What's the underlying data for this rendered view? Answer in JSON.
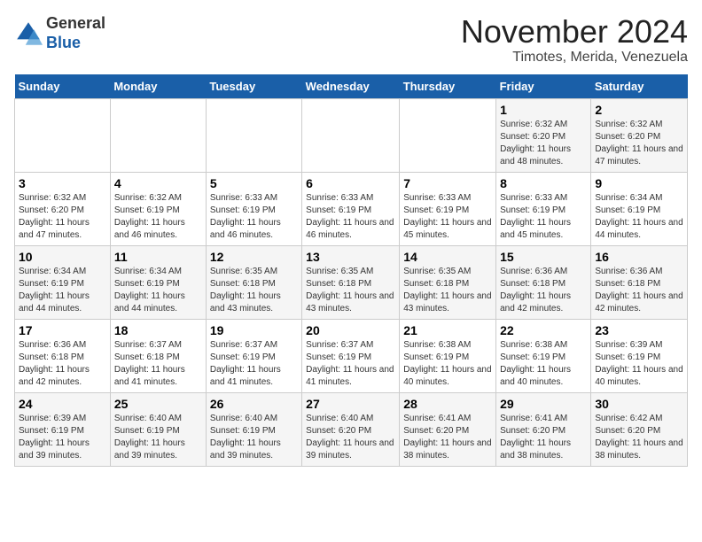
{
  "logo": {
    "general": "General",
    "blue": "Blue"
  },
  "header": {
    "month": "November 2024",
    "location": "Timotes, Merida, Venezuela"
  },
  "days_of_week": [
    "Sunday",
    "Monday",
    "Tuesday",
    "Wednesday",
    "Thursday",
    "Friday",
    "Saturday"
  ],
  "weeks": [
    [
      {
        "day": "",
        "info": ""
      },
      {
        "day": "",
        "info": ""
      },
      {
        "day": "",
        "info": ""
      },
      {
        "day": "",
        "info": ""
      },
      {
        "day": "",
        "info": ""
      },
      {
        "day": "1",
        "info": "Sunrise: 6:32 AM\nSunset: 6:20 PM\nDaylight: 11 hours and 48 minutes."
      },
      {
        "day": "2",
        "info": "Sunrise: 6:32 AM\nSunset: 6:20 PM\nDaylight: 11 hours and 47 minutes."
      }
    ],
    [
      {
        "day": "3",
        "info": "Sunrise: 6:32 AM\nSunset: 6:20 PM\nDaylight: 11 hours and 47 minutes."
      },
      {
        "day": "4",
        "info": "Sunrise: 6:32 AM\nSunset: 6:19 PM\nDaylight: 11 hours and 46 minutes."
      },
      {
        "day": "5",
        "info": "Sunrise: 6:33 AM\nSunset: 6:19 PM\nDaylight: 11 hours and 46 minutes."
      },
      {
        "day": "6",
        "info": "Sunrise: 6:33 AM\nSunset: 6:19 PM\nDaylight: 11 hours and 46 minutes."
      },
      {
        "day": "7",
        "info": "Sunrise: 6:33 AM\nSunset: 6:19 PM\nDaylight: 11 hours and 45 minutes."
      },
      {
        "day": "8",
        "info": "Sunrise: 6:33 AM\nSunset: 6:19 PM\nDaylight: 11 hours and 45 minutes."
      },
      {
        "day": "9",
        "info": "Sunrise: 6:34 AM\nSunset: 6:19 PM\nDaylight: 11 hours and 44 minutes."
      }
    ],
    [
      {
        "day": "10",
        "info": "Sunrise: 6:34 AM\nSunset: 6:19 PM\nDaylight: 11 hours and 44 minutes."
      },
      {
        "day": "11",
        "info": "Sunrise: 6:34 AM\nSunset: 6:19 PM\nDaylight: 11 hours and 44 minutes."
      },
      {
        "day": "12",
        "info": "Sunrise: 6:35 AM\nSunset: 6:18 PM\nDaylight: 11 hours and 43 minutes."
      },
      {
        "day": "13",
        "info": "Sunrise: 6:35 AM\nSunset: 6:18 PM\nDaylight: 11 hours and 43 minutes."
      },
      {
        "day": "14",
        "info": "Sunrise: 6:35 AM\nSunset: 6:18 PM\nDaylight: 11 hours and 43 minutes."
      },
      {
        "day": "15",
        "info": "Sunrise: 6:36 AM\nSunset: 6:18 PM\nDaylight: 11 hours and 42 minutes."
      },
      {
        "day": "16",
        "info": "Sunrise: 6:36 AM\nSunset: 6:18 PM\nDaylight: 11 hours and 42 minutes."
      }
    ],
    [
      {
        "day": "17",
        "info": "Sunrise: 6:36 AM\nSunset: 6:18 PM\nDaylight: 11 hours and 42 minutes."
      },
      {
        "day": "18",
        "info": "Sunrise: 6:37 AM\nSunset: 6:18 PM\nDaylight: 11 hours and 41 minutes."
      },
      {
        "day": "19",
        "info": "Sunrise: 6:37 AM\nSunset: 6:19 PM\nDaylight: 11 hours and 41 minutes."
      },
      {
        "day": "20",
        "info": "Sunrise: 6:37 AM\nSunset: 6:19 PM\nDaylight: 11 hours and 41 minutes."
      },
      {
        "day": "21",
        "info": "Sunrise: 6:38 AM\nSunset: 6:19 PM\nDaylight: 11 hours and 40 minutes."
      },
      {
        "day": "22",
        "info": "Sunrise: 6:38 AM\nSunset: 6:19 PM\nDaylight: 11 hours and 40 minutes."
      },
      {
        "day": "23",
        "info": "Sunrise: 6:39 AM\nSunset: 6:19 PM\nDaylight: 11 hours and 40 minutes."
      }
    ],
    [
      {
        "day": "24",
        "info": "Sunrise: 6:39 AM\nSunset: 6:19 PM\nDaylight: 11 hours and 39 minutes."
      },
      {
        "day": "25",
        "info": "Sunrise: 6:40 AM\nSunset: 6:19 PM\nDaylight: 11 hours and 39 minutes."
      },
      {
        "day": "26",
        "info": "Sunrise: 6:40 AM\nSunset: 6:19 PM\nDaylight: 11 hours and 39 minutes."
      },
      {
        "day": "27",
        "info": "Sunrise: 6:40 AM\nSunset: 6:20 PM\nDaylight: 11 hours and 39 minutes."
      },
      {
        "day": "28",
        "info": "Sunrise: 6:41 AM\nSunset: 6:20 PM\nDaylight: 11 hours and 38 minutes."
      },
      {
        "day": "29",
        "info": "Sunrise: 6:41 AM\nSunset: 6:20 PM\nDaylight: 11 hours and 38 minutes."
      },
      {
        "day": "30",
        "info": "Sunrise: 6:42 AM\nSunset: 6:20 PM\nDaylight: 11 hours and 38 minutes."
      }
    ]
  ]
}
